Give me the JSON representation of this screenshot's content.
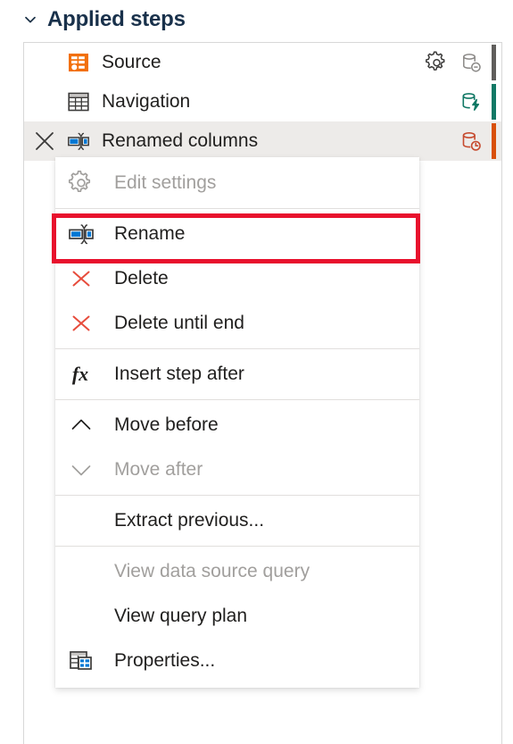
{
  "header": {
    "title": "Applied steps",
    "chevron_icon": "chevron-down-icon",
    "expanded": true
  },
  "steps_panel": {
    "steps": [
      {
        "label": "Source",
        "icon": "source-step-icon",
        "icon_color": "#F2700A",
        "has_gear": true,
        "gear_icon": "gear-icon",
        "folding_icon": "folding-not-supported-icon",
        "folding_color": "#8A8886",
        "bar_color": "#605E5C",
        "selected": false,
        "show_delete": false
      },
      {
        "label": "Navigation",
        "icon": "table-step-icon",
        "icon_color": "#3B3A39",
        "has_gear": false,
        "gear_icon": "gear-icon",
        "folding_icon": "folding-supported-icon",
        "folding_color": "#117865",
        "bar_color": "#117865",
        "selected": false,
        "show_delete": false
      },
      {
        "label": "Renamed columns",
        "icon": "rename-step-icon",
        "icon_color": "#0078D4",
        "has_gear": false,
        "gear_icon": "gear-icon",
        "folding_icon": "folding-pending-icon",
        "folding_color": "#C64A2E",
        "bar_color": "#D8500B",
        "selected": true,
        "show_delete": true,
        "delete_icon": "close-x-icon"
      }
    ]
  },
  "context_menu": {
    "highlight_color": "#E8112D",
    "highlighted_item": "Rename",
    "items": [
      {
        "label": "Edit settings",
        "icon": "gear-icon",
        "disabled": true,
        "type": "item"
      },
      {
        "type": "separator"
      },
      {
        "label": "Rename",
        "icon": "rename-icon",
        "disabled": false,
        "type": "item",
        "highlighted": true
      },
      {
        "label": "Delete",
        "icon": "delete-x-icon",
        "disabled": false,
        "type": "item"
      },
      {
        "label": "Delete until end",
        "icon": "delete-x-icon",
        "disabled": false,
        "type": "item"
      },
      {
        "type": "separator"
      },
      {
        "label": "Insert step after",
        "icon": "fx-icon",
        "disabled": false,
        "type": "item"
      },
      {
        "type": "separator"
      },
      {
        "label": "Move before",
        "icon": "chevron-up-icon",
        "disabled": false,
        "type": "item"
      },
      {
        "label": "Move after",
        "icon": "chevron-down-icon",
        "disabled": true,
        "type": "item"
      },
      {
        "type": "separator"
      },
      {
        "label": "Extract previous...",
        "icon": "none",
        "disabled": false,
        "type": "item"
      },
      {
        "type": "separator"
      },
      {
        "label": "View data source query",
        "icon": "none",
        "disabled": true,
        "type": "item"
      },
      {
        "label": "View query plan",
        "icon": "none",
        "disabled": false,
        "type": "item"
      },
      {
        "label": "Properties...",
        "icon": "properties-icon",
        "disabled": false,
        "type": "item"
      }
    ]
  }
}
